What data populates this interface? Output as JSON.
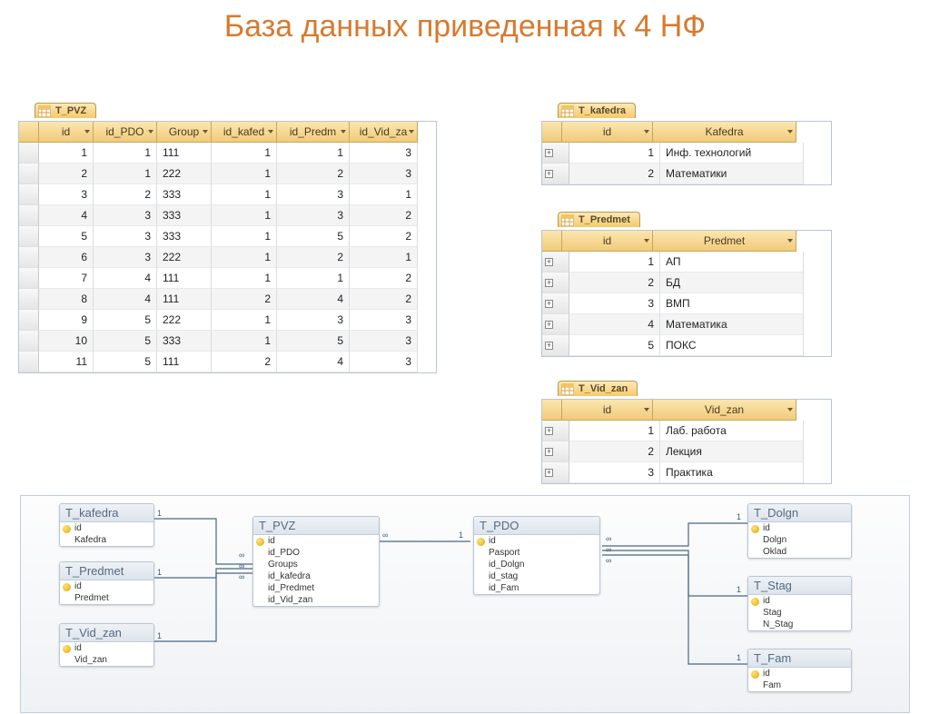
{
  "title": "База данных приведенная к 4 НФ",
  "t_pvz": {
    "tab": "T_PVZ",
    "cols": [
      "id",
      "id_PDO",
      "Group",
      "id_kafed",
      "id_Predm",
      "id_Vid_za"
    ],
    "rows": [
      {
        "id": 1,
        "pdo": 1,
        "grp": "111",
        "kaf": 1,
        "prd": 1,
        "vid": 3
      },
      {
        "id": 2,
        "pdo": 1,
        "grp": "222",
        "kaf": 1,
        "prd": 2,
        "vid": 3
      },
      {
        "id": 3,
        "pdo": 2,
        "grp": "333",
        "kaf": 1,
        "prd": 3,
        "vid": 1
      },
      {
        "id": 4,
        "pdo": 3,
        "grp": "333",
        "kaf": 1,
        "prd": 3,
        "vid": 2
      },
      {
        "id": 5,
        "pdo": 3,
        "grp": "333",
        "kaf": 1,
        "prd": 5,
        "vid": 2
      },
      {
        "id": 6,
        "pdo": 3,
        "grp": "222",
        "kaf": 1,
        "prd": 2,
        "vid": 1
      },
      {
        "id": 7,
        "pdo": 4,
        "grp": "111",
        "kaf": 1,
        "prd": 1,
        "vid": 2
      },
      {
        "id": 8,
        "pdo": 4,
        "grp": "111",
        "kaf": 2,
        "prd": 4,
        "vid": 2
      },
      {
        "id": 9,
        "pdo": 5,
        "grp": "222",
        "kaf": 1,
        "prd": 3,
        "vid": 3
      },
      {
        "id": 10,
        "pdo": 5,
        "grp": "333",
        "kaf": 1,
        "prd": 5,
        "vid": 3
      },
      {
        "id": 11,
        "pdo": 5,
        "grp": "111",
        "kaf": 2,
        "prd": 4,
        "vid": 3
      }
    ]
  },
  "t_kafedra": {
    "tab": "T_kafedra",
    "cols": [
      "id",
      "Kafedra"
    ],
    "rows": [
      {
        "id": 1,
        "txt": "Инф. технологий"
      },
      {
        "id": 2,
        "txt": "Математики"
      }
    ]
  },
  "t_predmet": {
    "tab": "T_Predmet",
    "cols": [
      "id",
      "Predmet"
    ],
    "rows": [
      {
        "id": 1,
        "txt": "АП"
      },
      {
        "id": 2,
        "txt": "БД"
      },
      {
        "id": 3,
        "txt": "ВМП"
      },
      {
        "id": 4,
        "txt": "Математика"
      },
      {
        "id": 5,
        "txt": "ПОКС"
      }
    ]
  },
  "t_vidzan": {
    "tab": "T_Vid_zan",
    "cols": [
      "id",
      "Vid_zan"
    ],
    "rows": [
      {
        "id": 1,
        "txt": "Лаб. работа"
      },
      {
        "id": 2,
        "txt": "Лекция"
      },
      {
        "id": 3,
        "txt": "Практика"
      }
    ]
  },
  "er": {
    "t_kafedra": {
      "title": "T_kafedra",
      "fields": [
        {
          "n": "id",
          "pk": true
        },
        {
          "n": "Kafedra"
        }
      ]
    },
    "t_predmet": {
      "title": "T_Predmet",
      "fields": [
        {
          "n": "id",
          "pk": true
        },
        {
          "n": "Predmet"
        }
      ]
    },
    "t_vidzan": {
      "title": "T_Vid_zan",
      "fields": [
        {
          "n": "id",
          "pk": true
        },
        {
          "n": "Vid_zan"
        }
      ]
    },
    "t_pvz": {
      "title": "T_PVZ",
      "fields": [
        {
          "n": "id",
          "pk": true
        },
        {
          "n": "id_PDO"
        },
        {
          "n": "Groups"
        },
        {
          "n": "id_kafedra"
        },
        {
          "n": "id_Predmet"
        },
        {
          "n": "id_Vid_zan"
        }
      ]
    },
    "t_pdo": {
      "title": "T_PDO",
      "fields": [
        {
          "n": "id",
          "pk": true
        },
        {
          "n": "Pasport"
        },
        {
          "n": "id_Dolgn"
        },
        {
          "n": "id_stag"
        },
        {
          "n": "id_Fam"
        }
      ]
    },
    "t_dolgn": {
      "title": "T_Dolgn",
      "fields": [
        {
          "n": "id",
          "pk": true
        },
        {
          "n": "Dolgn"
        },
        {
          "n": "Oklad"
        }
      ]
    },
    "t_stag": {
      "title": "T_Stag",
      "fields": [
        {
          "n": "id",
          "pk": true
        },
        {
          "n": "Stag"
        },
        {
          "n": "N_Stag"
        }
      ]
    },
    "t_fam": {
      "title": "T_Fam",
      "fields": [
        {
          "n": "id",
          "pk": true
        },
        {
          "n": "Fam"
        }
      ]
    }
  },
  "labels": {
    "one": "1"
  }
}
